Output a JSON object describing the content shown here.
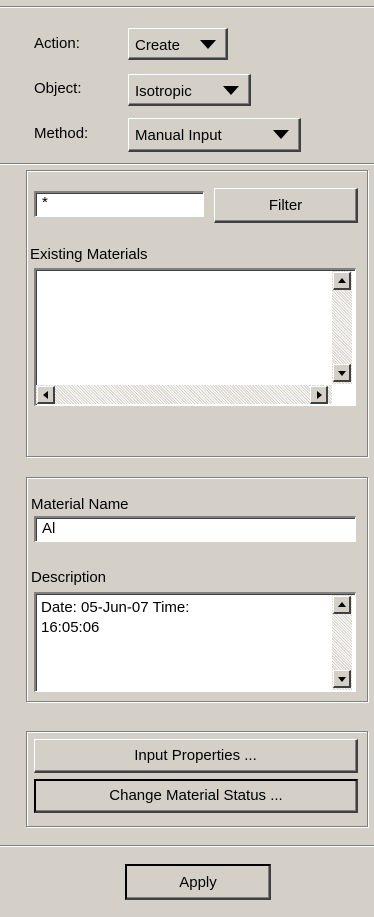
{
  "header": {
    "action": {
      "label": "Action:",
      "value": "Create"
    },
    "object": {
      "label": "Object:",
      "value": "Isotropic"
    },
    "method": {
      "label": "Method:",
      "value": "Manual Input"
    }
  },
  "filter": {
    "input_value": "*",
    "button_label": "Filter",
    "existing_label": "Existing Materials",
    "existing_items": []
  },
  "material": {
    "name_label": "Material Name",
    "name_value": "Al",
    "description_label": "Description",
    "description_line1": "Date: 05-Jun-07        Time:",
    "description_line2": "16:05:06"
  },
  "actions": {
    "input_properties": "Input Properties ...",
    "change_status": "Change Material Status ..."
  },
  "footer": {
    "apply": "Apply"
  }
}
